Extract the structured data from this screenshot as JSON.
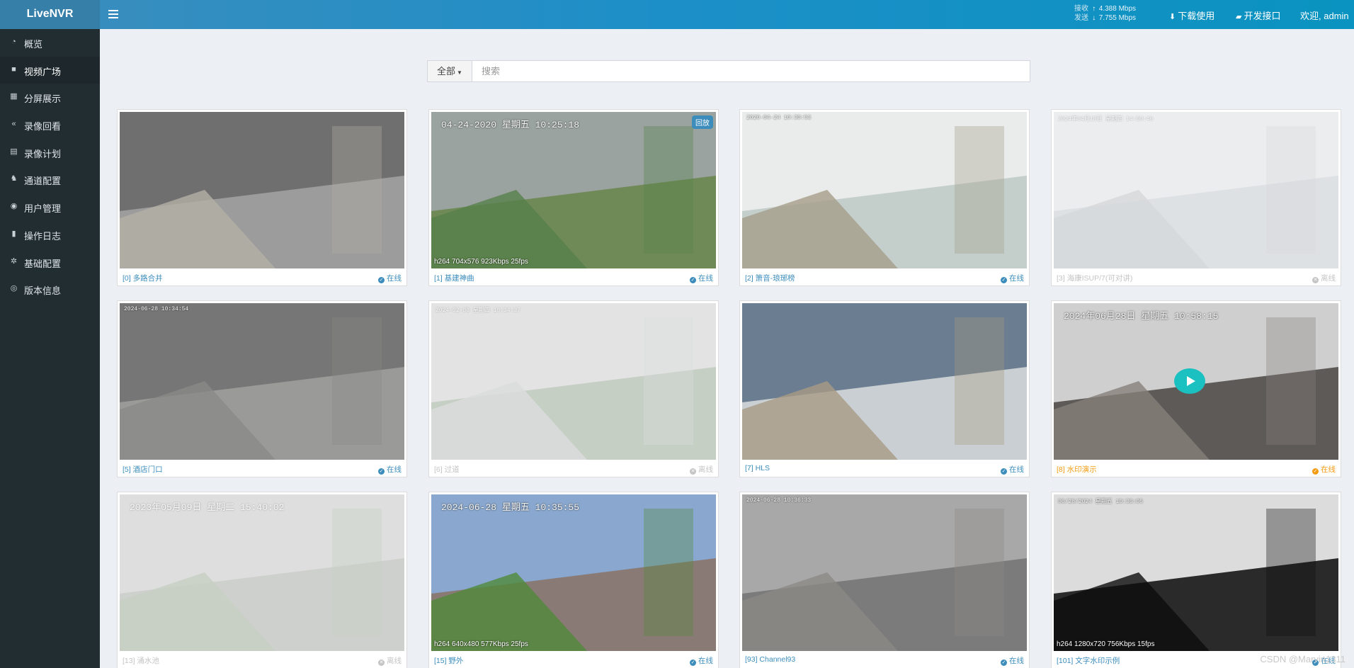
{
  "app": {
    "logo": "LiveNVR"
  },
  "header": {
    "recv_label": "接收",
    "recv_value": "4.388 Mbps",
    "send_label": "发送",
    "send_value": "7.755 Mbps",
    "download_label": "下载使用",
    "api_label": "开发接口",
    "welcome": "欢迎, admin"
  },
  "sidebar": {
    "items": [
      {
        "label": "概览",
        "icon": "dashboard-icon"
      },
      {
        "label": "视频广场",
        "icon": "video-camera-icon",
        "active": true
      },
      {
        "label": "分屏展示",
        "icon": "grid-icon"
      },
      {
        "label": "录像回看",
        "icon": "rewind-icon"
      },
      {
        "label": "录像计划",
        "icon": "calendar-icon"
      },
      {
        "label": "通道配置",
        "icon": "sitemap-icon"
      },
      {
        "label": "用户管理",
        "icon": "users-icon"
      },
      {
        "label": "操作日志",
        "icon": "file-icon"
      },
      {
        "label": "基础配置",
        "icon": "cogs-icon"
      },
      {
        "label": "版本信息",
        "icon": "globe-icon"
      }
    ]
  },
  "search": {
    "filter_label": "全部",
    "placeholder": "搜索"
  },
  "status_labels": {
    "online": "在线",
    "offline": "离线"
  },
  "cards": [
    {
      "name": "[0] 多路合并",
      "status": "在线",
      "state": "online",
      "timestamp": "",
      "codec": "",
      "badge": ""
    },
    {
      "name": "[1] 基建神曲",
      "status": "在线",
      "state": "online",
      "timestamp": "04-24-2020  星期五  10:25:18",
      "codec": "h264 704x576 923Kbps 25fps",
      "badge": "回放"
    },
    {
      "name": "[2] 箫音-琅琊榜",
      "status": "在线",
      "state": "online",
      "timestamp": "2020-04-24 10:30:53",
      "codec": "",
      "badge": ""
    },
    {
      "name": "[3] 海康ISUP/7(可对讲)",
      "status": "离线",
      "state": "offline",
      "timestamp": "2024年04月18日  星期四  14:00:46",
      "codec": "",
      "badge": ""
    },
    {
      "name": "[5] 酒店门口",
      "status": "在线",
      "state": "online",
      "timestamp": "2024-06-28 10:34:54",
      "codec": "",
      "badge": ""
    },
    {
      "name": "[6] 过道",
      "status": "离线",
      "state": "offline",
      "timestamp": "2024-02-08  星期四  10:34:37",
      "codec": "",
      "badge": ""
    },
    {
      "name": "[7] HLS",
      "status": "在线",
      "state": "online",
      "timestamp": "",
      "codec": "",
      "badge": ""
    },
    {
      "name": "[8] 水印演示",
      "status": "在线",
      "state": "warn",
      "timestamp": "2024年06月28日  星期五  10:58:15",
      "codec": "",
      "badge": ""
    },
    {
      "name": "[13] 涌水池",
      "status": "离线",
      "state": "offline",
      "timestamp": "2023年05月09日  星期二  15:40:02",
      "codec": "",
      "badge": ""
    },
    {
      "name": "[15] 野外",
      "status": "在线",
      "state": "online",
      "timestamp": "2024-06-28  星期五  10:35:55",
      "codec": "h264 640x480 577Kbps 25fps",
      "badge": ""
    },
    {
      "name": "[93] Channel93",
      "status": "在线",
      "state": "online",
      "timestamp": "2024-06-28 10:36:33",
      "codec": "",
      "badge": ""
    },
    {
      "name": "[101] 文字水印示例",
      "status": "在线",
      "state": "online",
      "timestamp": "06/28/2024  星期五  10:36:05",
      "codec": "h264 1280x720 756Kbps 15fps",
      "badge": ""
    }
  ],
  "watermark": "CSDN @Marvin1311",
  "colors": {
    "header": "#3c8dbc",
    "sidebar": "#222d32",
    "online": "#3c8dbc",
    "offline": "#c4c4c4",
    "warn": "#f39c12"
  }
}
